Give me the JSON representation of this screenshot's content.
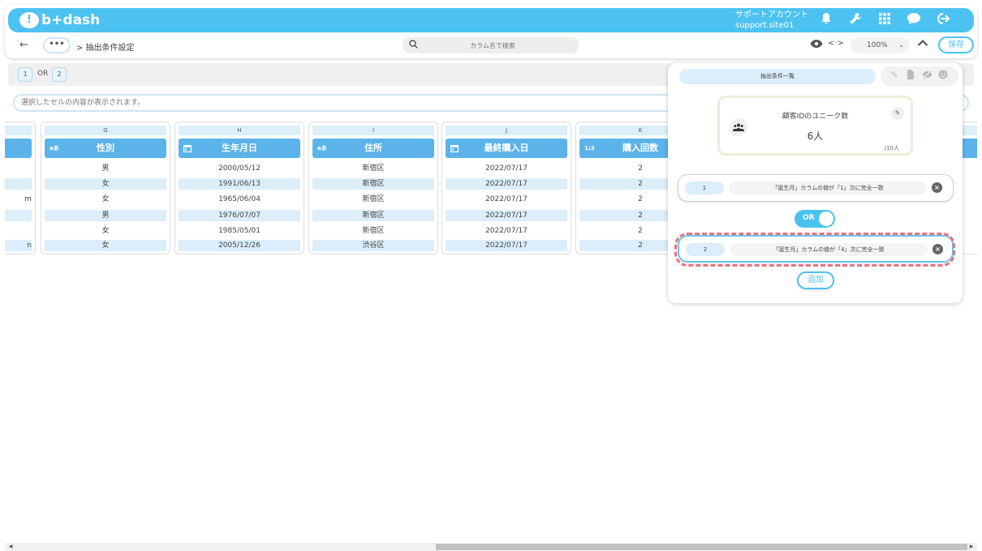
{
  "header": {
    "logo": "b+dash",
    "account_label": "サポートアカウント",
    "account_site": "support.site01",
    "icons": [
      "bell-icon",
      "wrench-icon",
      "grid-icon",
      "chat-icon",
      "logout-icon"
    ]
  },
  "subbar": {
    "back": "←",
    "more": "•••",
    "breadcrumb": "> 抽出条件設定",
    "search_placeholder": "カラム名で検索",
    "code_icon": "<·>",
    "zoom": "100%",
    "save": "保存"
  },
  "condition_strip": {
    "items": [
      "1",
      "2"
    ],
    "operator": "OR"
  },
  "cell_bar": {
    "placeholder": "選択したセルの内容が表示されます。"
  },
  "grid": {
    "partial_left_col": {
      "cells": [
        "",
        "",
        "m",
        "",
        "",
        "n"
      ]
    },
    "columns": [
      {
        "letter": "G",
        "type": "aあ",
        "header": "性別",
        "cells": [
          "男",
          "女",
          "女",
          "男",
          "女",
          "女"
        ]
      },
      {
        "letter": "H",
        "type": "date",
        "header": "生年月日",
        "cells": [
          "2000/05/12",
          "1991/06/13",
          "1965/06/04",
          "1976/07/07",
          "1985/05/01",
          "2005/12/26"
        ]
      },
      {
        "letter": "I",
        "type": "aあ",
        "header": "住所",
        "cells": [
          "新宿区",
          "新宿区",
          "新宿区",
          "新宿区",
          "新宿区",
          "渋谷区"
        ]
      },
      {
        "letter": "J",
        "type": "date",
        "header": "最終購入日",
        "cells": [
          "2022/07/17",
          "2022/07/17",
          "2022/07/17",
          "2022/07/17",
          "2022/07/17",
          "2022/07/17"
        ]
      },
      {
        "letter": "K",
        "type": "1₂3",
        "header": "購入回数",
        "cells": [
          "2",
          "2",
          "2",
          "2",
          "2",
          "2"
        ]
      }
    ]
  },
  "panel": {
    "tab_label": "抽出条件一覧",
    "stat": {
      "title": "顧客IDのユニーク数",
      "value": "6人",
      "total": "/10人"
    },
    "conditions": [
      {
        "num": "1",
        "text": "「誕生月」カラムの値が「1」次に完全一致"
      },
      {
        "num": "2",
        "text": "「誕生月」カラムの値が「4」次に完全一致"
      }
    ],
    "operator": "OR",
    "add_label": "追加"
  },
  "colors": {
    "brand": "#4cc2f1",
    "header_cell": "#5bb3ea",
    "row_alt": "#dbeef9",
    "highlight": "#e8737c"
  }
}
